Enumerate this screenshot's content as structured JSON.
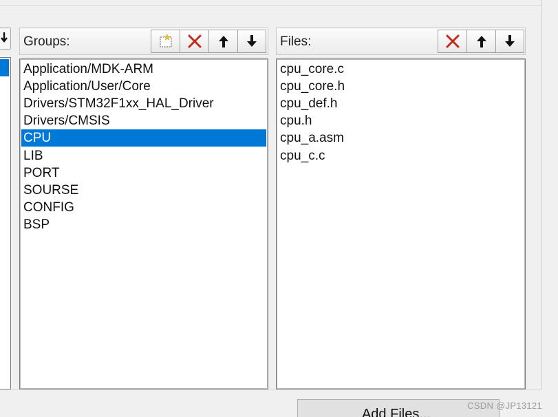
{
  "groups": {
    "label": "Groups:",
    "toolbar": {
      "new_icon": "new-folder-icon",
      "delete_icon": "delete-x-icon",
      "up_icon": "arrow-up-icon",
      "down_icon": "arrow-down-icon"
    },
    "items": [
      "Application/MDK-ARM",
      "Application/User/Core",
      "Drivers/STM32F1xx_HAL_Driver",
      "Drivers/CMSIS",
      "CPU",
      "LIB",
      "PORT",
      "SOURSE",
      "CONFIG",
      "BSP"
    ],
    "selected": "CPU"
  },
  "files": {
    "label": "Files:",
    "toolbar": {
      "delete_icon": "delete-x-icon",
      "up_icon": "arrow-up-icon",
      "down_icon": "arrow-down-icon"
    },
    "items": [
      "cpu_core.c",
      "cpu_core.h",
      "cpu_def.h",
      "cpu.h",
      "cpu_a.asm",
      "cpu_c.c"
    ]
  },
  "add_files_label": "Add Files...",
  "watermark": "CSDN @JP13121",
  "colors": {
    "selection": "#0078d7",
    "delete_red": "#c42b1c"
  }
}
